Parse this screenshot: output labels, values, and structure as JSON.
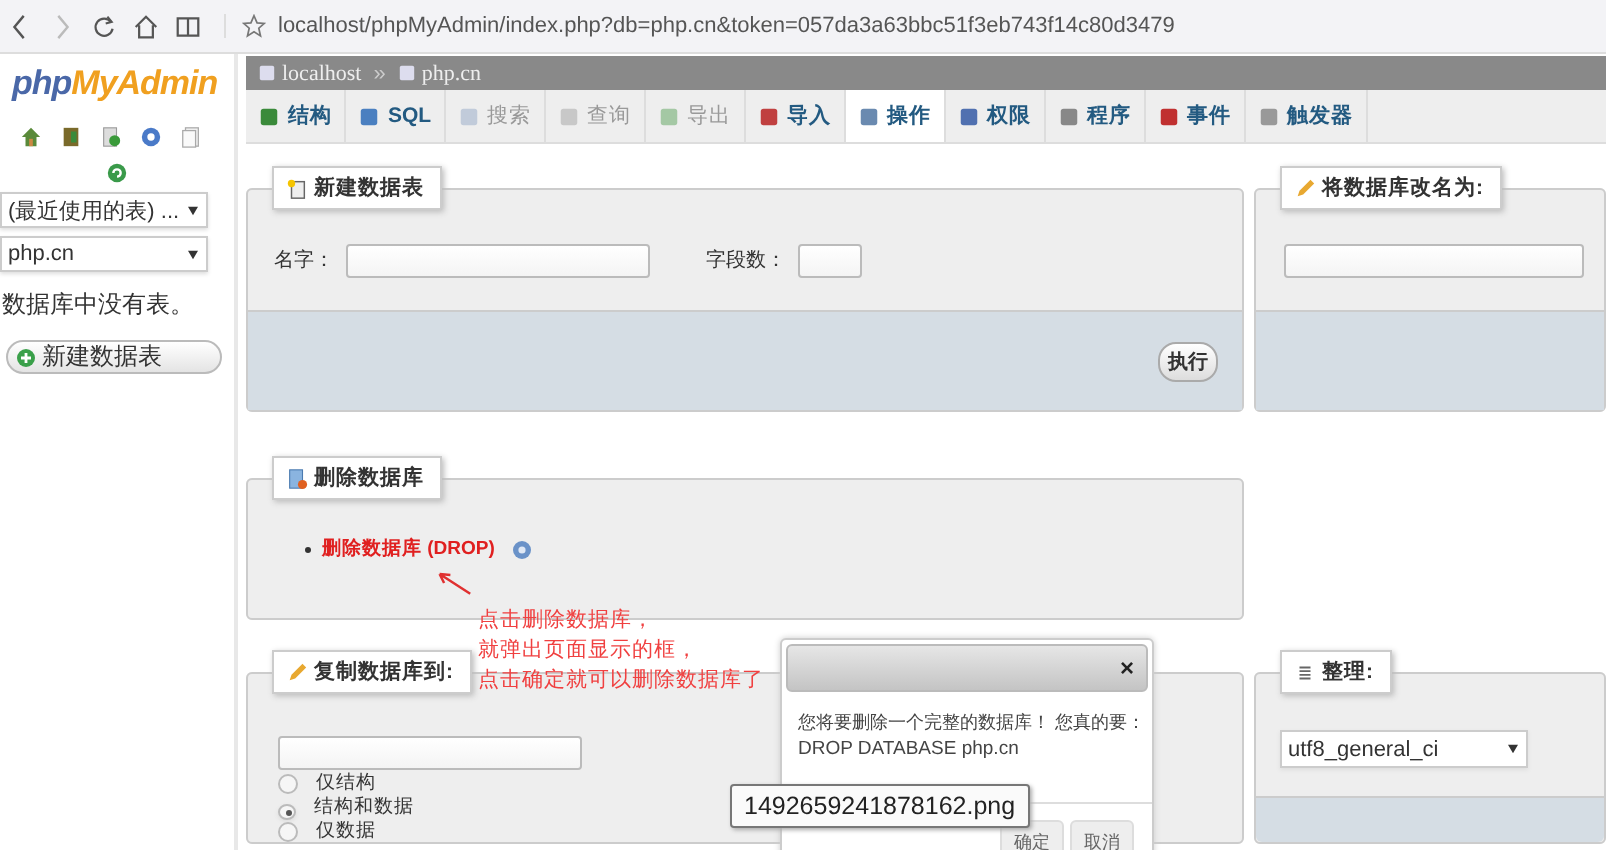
{
  "browser": {
    "url": "localhost/phpMyAdmin/index.php?db=php.cn&token=057da3a63bbc51f3eb743f14c80d3479"
  },
  "sidebar": {
    "logo": {
      "prefix": "php",
      "main": "MyAdmin"
    },
    "recent_tables": "(最近使用的表) ...",
    "database": "php.cn",
    "message": "数据库中没有表。",
    "new_table_button": "新建数据表"
  },
  "breadcrumb": [
    {
      "label": "localhost"
    },
    {
      "label": "php.cn"
    }
  ],
  "breadcrumb_separator": "»",
  "tabs": [
    {
      "label": "结构",
      "selected": false,
      "disabled": false
    },
    {
      "label": "SQL",
      "selected": false,
      "disabled": false
    },
    {
      "label": "搜索",
      "selected": false,
      "disabled": true
    },
    {
      "label": "查询",
      "selected": false,
      "disabled": true
    },
    {
      "label": "导出",
      "selected": false,
      "disabled": true
    },
    {
      "label": "导入",
      "selected": false,
      "disabled": false
    },
    {
      "label": "操作",
      "selected": true,
      "disabled": false
    },
    {
      "label": "权限",
      "selected": false,
      "disabled": false
    },
    {
      "label": "程序",
      "selected": false,
      "disabled": false
    },
    {
      "label": "事件",
      "selected": false,
      "disabled": false
    },
    {
      "label": "触发器",
      "selected": false,
      "disabled": false
    }
  ],
  "create_table": {
    "title": "新建数据表",
    "name_label": "名字：",
    "fields_label": "字段数：",
    "button": "执行"
  },
  "rename_db": {
    "title": "将数据库改名为:"
  },
  "drop_db": {
    "title": "删除数据库",
    "link": "删除数据库 (DROP)"
  },
  "copy_db": {
    "title": "复制数据库到:",
    "options": [
      {
        "label": "仅结构",
        "selected": false
      },
      {
        "label": "结构和数据",
        "selected": true
      },
      {
        "label": "仅数据",
        "selected": false
      }
    ]
  },
  "collation": {
    "title": "整理:",
    "value": "utf8_general_ci"
  },
  "annotation": {
    "lines": [
      "点击删除数据库，",
      "就弹出页面显示的框，",
      "点击确定就可以删除数据库了"
    ]
  },
  "dialog": {
    "close": "×",
    "message": "您将要删除一个完整的数据库！ 您真的要：",
    "sql": "DROP DATABASE php.cn",
    "buttons": [
      "确定",
      "取消"
    ]
  },
  "tooltip": "1492659241878162.png"
}
